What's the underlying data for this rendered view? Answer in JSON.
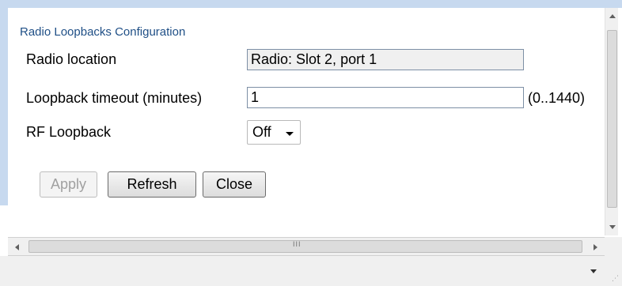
{
  "section_title": "Radio Loopbacks Configuration",
  "fields": {
    "radio_location": {
      "label": "Radio location",
      "value": "Radio: Slot 2, port 1"
    },
    "loopback_timeout": {
      "label": "Loopback timeout (minutes)",
      "value": "1",
      "range_hint": "(0..1440)"
    },
    "rf_loopback": {
      "label": "RF Loopback",
      "selected": "Off"
    }
  },
  "buttons": {
    "apply": "Apply",
    "refresh": "Refresh",
    "close": "Close"
  },
  "scrollbar": {
    "grip": "III"
  },
  "colors": {
    "title": "#1f4f86",
    "frame": "#c7d9ef",
    "chrome": "#f0f0f0"
  }
}
